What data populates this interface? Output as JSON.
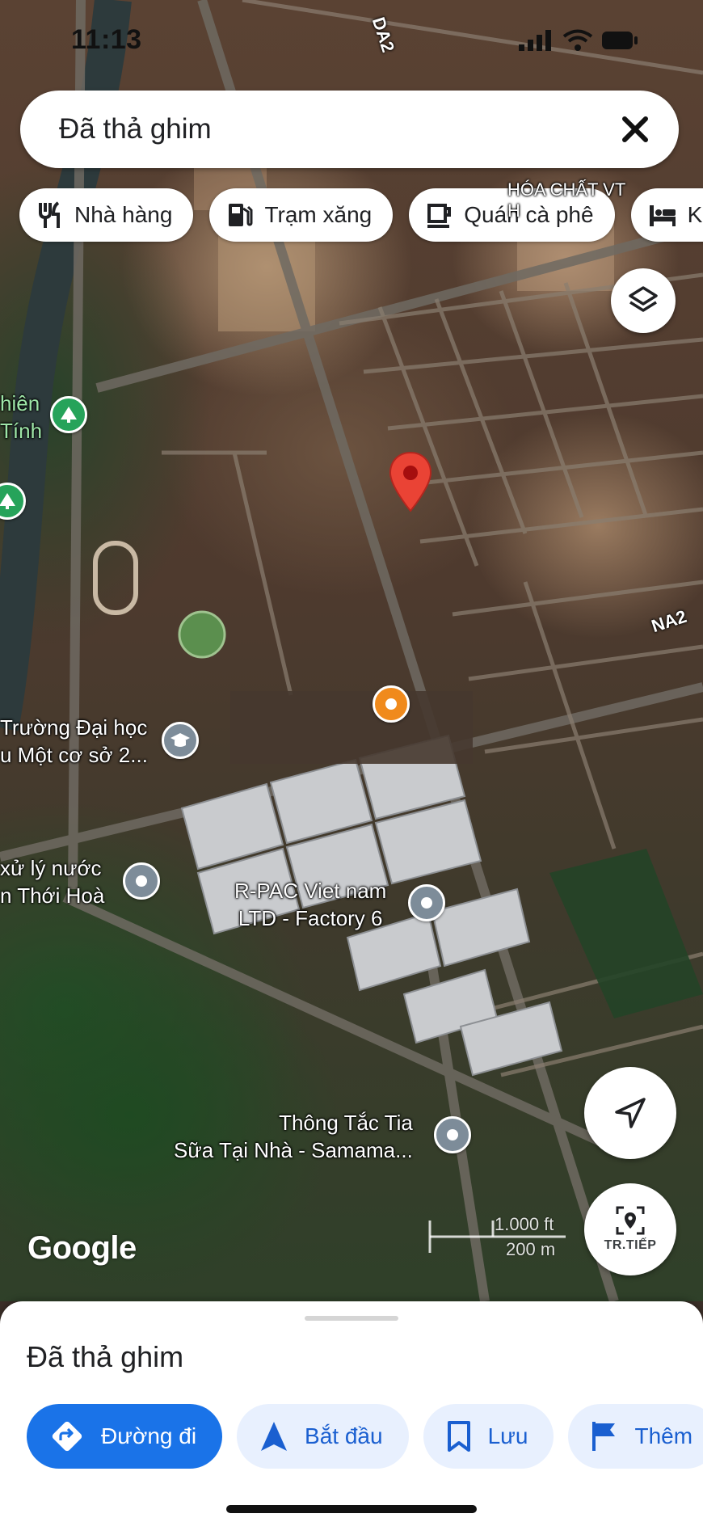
{
  "status_bar": {
    "time": "11:13"
  },
  "search": {
    "text": "Đã thả ghim"
  },
  "chips": [
    {
      "label": "Nhà hàng",
      "icon": "fork-knife-icon"
    },
    {
      "label": "Trạm xăng",
      "icon": "gas-station-icon"
    },
    {
      "label": "Quán cà phê",
      "icon": "coffee-cup-icon"
    },
    {
      "label": "Kh",
      "icon": "bed-icon"
    }
  ],
  "map": {
    "pois": {
      "university": "Trường Đại học\nu Một cơ sở 2...",
      "water": "xử lý nước\nn Thới Hoà",
      "factory": "R-PAC Viet nam\nLTD - Factory 6",
      "service": "Thông Tắc Tia\nSữa Tại Nhà - Samama...",
      "park": "hiên\nTính",
      "chemical": "HÓA CHẤT VT\nH"
    },
    "roads": {
      "da2": "DA2",
      "na2": "NA2"
    },
    "logo": "Google",
    "scale_top": "1.000 ft",
    "scale_bottom": "200 m",
    "next_up_label": "TR.TIẾP"
  },
  "sheet": {
    "title": "Đã thả ghim",
    "actions": [
      {
        "label": "Đường đi",
        "icon": "directions-icon"
      },
      {
        "label": "Bắt đầu",
        "icon": "navigation-arrow-icon"
      },
      {
        "label": "Lưu",
        "icon": "bookmark-icon"
      },
      {
        "label": "Thêm",
        "icon": "flag-icon"
      }
    ]
  },
  "colors": {
    "accent": "#1a73e8",
    "accent_light": "#e8f0fe",
    "pin": "#ea4335",
    "poi_grey": "#7d8c99"
  }
}
